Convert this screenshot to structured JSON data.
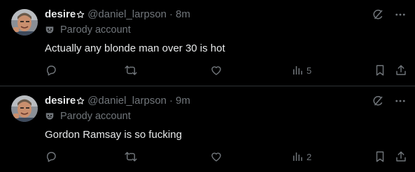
{
  "posts": [
    {
      "display_name": "desire",
      "handle": "@daniel_larpson",
      "separator": "·",
      "time": "8m",
      "parody_label": "Parody account",
      "text": "Actually any blonde man over 30 is hot",
      "views": "5"
    },
    {
      "display_name": "desire",
      "handle": "@daniel_larpson",
      "separator": "·",
      "time": "9m",
      "parody_label": "Parody account",
      "text": "Gordon Ramsay is so fucking",
      "views": "2"
    }
  ],
  "colors": {
    "background": "#000000",
    "primary_text": "#e7e9ea",
    "secondary_text": "#71767b",
    "divider": "#2f3336"
  },
  "icons": {
    "badge": "star-outline-icon",
    "parody": "mask-icon",
    "grok": "grok-icon",
    "more": "more-icon",
    "reply": "reply-icon",
    "repost": "repost-icon",
    "like": "heart-icon",
    "views": "views-icon",
    "bookmark": "bookmark-icon",
    "share": "share-icon"
  }
}
